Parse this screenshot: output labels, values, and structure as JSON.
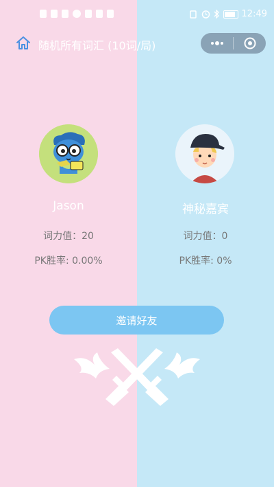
{
  "status_bar": {
    "time": "12:49"
  },
  "header": {
    "title": "随机所有词汇 (10词/局)"
  },
  "players": [
    {
      "name": "Jason",
      "power_label": "词力值：",
      "power_value": "20",
      "pk_label": "PK胜率: ",
      "pk_value": "0.00%"
    },
    {
      "name": "神秘嘉宾",
      "power_label": "词力值：",
      "power_value": "0",
      "pk_label": "PK胜率: ",
      "pk_value": "0%"
    }
  ],
  "invite_button": {
    "label": "邀请好友"
  },
  "colors": {
    "left_bg": "#f9d9e8",
    "right_bg": "#c5e8f7",
    "button": "#7cc6f2",
    "capsule": "#8aa3b6"
  },
  "icons": [
    "home-icon",
    "more-icon",
    "close-circle-icon",
    "crossed-swords-icon"
  ]
}
